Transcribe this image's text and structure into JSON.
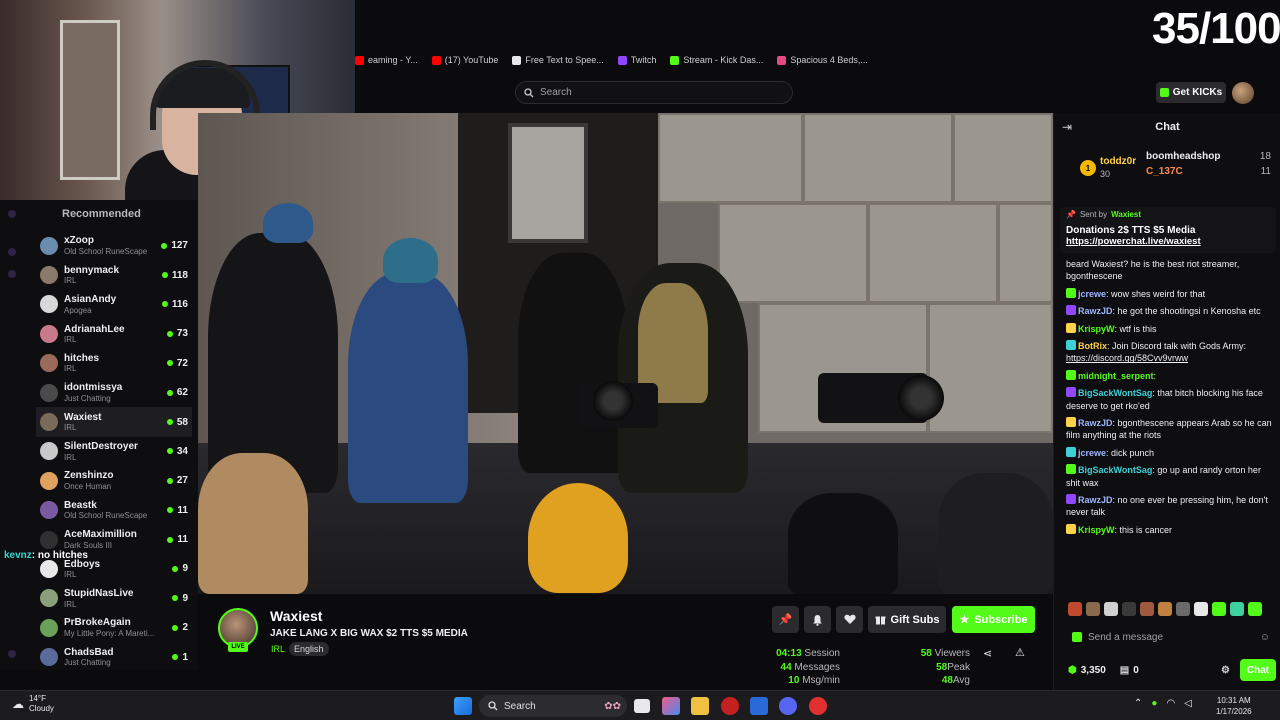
{
  "counter": "35/100",
  "bookmarks": [
    {
      "label": "eaming - Y...",
      "icon": "youtube-icon",
      "color": "#ff0000"
    },
    {
      "label": "(17) YouTube",
      "icon": "youtube-icon",
      "color": "#ff0000"
    },
    {
      "label": "Free Text to Spee...",
      "icon": "document-icon",
      "color": "#e8e8ea"
    },
    {
      "label": "Twitch",
      "icon": "twitch-icon",
      "color": "#9146ff"
    },
    {
      "label": "Stream - Kick Das...",
      "icon": "kick-icon",
      "color": "#53fc18"
    },
    {
      "label": "Spacious 4 Beds,...",
      "icon": "home-icon",
      "color": "#e64980"
    }
  ],
  "search": {
    "placeholder": "Search"
  },
  "header": {
    "get_kicks": "Get KICKs"
  },
  "sidebar": {
    "title": "Recommended",
    "overlay": {
      "user": "kevnz",
      "text": ": no hitches"
    },
    "items": [
      {
        "name": "xZoop",
        "category": "Old School RuneScape",
        "viewers": "127",
        "color": "#6a8cae"
      },
      {
        "name": "bennymack",
        "category": "IRL",
        "viewers": "118",
        "color": "#8a7a6a"
      },
      {
        "name": "AsianAndy",
        "category": "Apogea",
        "viewers": "116",
        "color": "#d8d8d8"
      },
      {
        "name": "AdrianahLee",
        "category": "IRL",
        "viewers": "73",
        "color": "#c97a8a"
      },
      {
        "name": "hitches",
        "category": "IRL",
        "viewers": "72",
        "color": "#9a6a5a"
      },
      {
        "name": "idontmissya",
        "category": "Just Chatting",
        "viewers": "62",
        "color": "#4a4a4a"
      },
      {
        "name": "Waxiest",
        "category": "IRL",
        "viewers": "58",
        "color": "#7a6a5a"
      },
      {
        "name": "SilentDestroyer",
        "category": "IRL",
        "viewers": "34",
        "color": "#c8c8c8"
      },
      {
        "name": "Zenshinzo",
        "category": "Once Human",
        "viewers": "27",
        "color": "#e0a060"
      },
      {
        "name": "Beastk",
        "category": "Old School RuneScape",
        "viewers": "11",
        "color": "#7a5aa0"
      },
      {
        "name": "AceMaximillion",
        "category": "Dark Souls III",
        "viewers": "11",
        "color": "#303030"
      },
      {
        "name": "Edboys",
        "category": "IRL",
        "viewers": "9",
        "color": "#e8e8e8"
      },
      {
        "name": "StupidNasLive",
        "category": "IRL",
        "viewers": "9",
        "color": "#8aa07a"
      },
      {
        "name": "PrBrokeAgain",
        "category": "My Little Pony: A Mareti...",
        "viewers": "2",
        "color": "#6aa05a"
      },
      {
        "name": "ChadsBad",
        "category": "Just Chatting",
        "viewers": "1",
        "color": "#5a6a9a"
      }
    ]
  },
  "stream": {
    "streamer": "Waxiest",
    "title": "JAKE LANG X BIG WAX $2 TTS $5 MEDIA",
    "category": "IRL",
    "language": "English",
    "gift_subs": "Gift Subs",
    "subscribe": "Subscribe",
    "stats": {
      "session": "04:13",
      "session_label": "Session",
      "messages": "44",
      "messages_label": "Messages",
      "msg_rate": "10",
      "msg_rate_label": "Msg/min",
      "viewers": "58",
      "viewers_label": "Viewers",
      "peak": "58",
      "peak_label": "Peak",
      "avg": "48",
      "avg_label": "Avg"
    }
  },
  "chat": {
    "title": "Chat",
    "gifters": [
      {
        "rank": "1",
        "name": "toddz0r",
        "count": "30"
      },
      {
        "name": "boomheadshop",
        "count": "18"
      },
      {
        "name": "C_137C",
        "count": "11"
      }
    ],
    "pinned": {
      "sent_by_label": "Sent by",
      "sent_by": "Waxiest",
      "text": "Donations 2$ TTS $5 Media",
      "link": "https://powerchat.live/waxiest"
    },
    "messages": [
      {
        "user": "",
        "text": "beard Waxiest? he is the best riot streamer, bgonthescene",
        "color": "#efeff1"
      },
      {
        "user": "jcrewe",
        "text": ": wow shes weird for that",
        "color": "#9fb7ff"
      },
      {
        "user": "RawzJD",
        "text": ": he got the shootingsi n Kenosha etc",
        "color": "#9fb7ff"
      },
      {
        "user": "KrispyW",
        "text": ": wtf is this",
        "color": "#53fc18"
      },
      {
        "user": "BotRix",
        "text": ": Join Discord talk with Gods Army: ",
        "link": "https://discord.gg/58Cvv9vrww",
        "color": "#ffd24a"
      },
      {
        "user": "midnight_serpent",
        "text": ":",
        "color": "#53fc18"
      },
      {
        "user": "BigSackWontSag",
        "text": ": that bitch blocking his face deserve to get rko'ed",
        "color": "#3fd0d6"
      },
      {
        "user": "RawzJD",
        "text": ": bgonthescene appears Arab so he can film anything at the riots",
        "color": "#9fb7ff"
      },
      {
        "user": "jcrewe",
        "text": ": dick punch",
        "color": "#9fb7ff"
      },
      {
        "user": "BigSackWontSag",
        "text": ": go up and randy orton her shit wax",
        "color": "#3fd0d6"
      },
      {
        "user": "RawzJD",
        "text": ": no one ever be pressing him, he don't never talk",
        "color": "#9fb7ff"
      },
      {
        "user": "KrispyW",
        "text": ": this is cancer",
        "color": "#53fc18"
      }
    ],
    "input_placeholder": "Send a message",
    "kicks_balance": "3,350",
    "count": "0",
    "send": "Chat"
  },
  "taskbar": {
    "weather_temp": "14°F",
    "weather_desc": "Cloudy",
    "search": "Search",
    "time": "10:31 AM",
    "date": "1/17/2026"
  }
}
